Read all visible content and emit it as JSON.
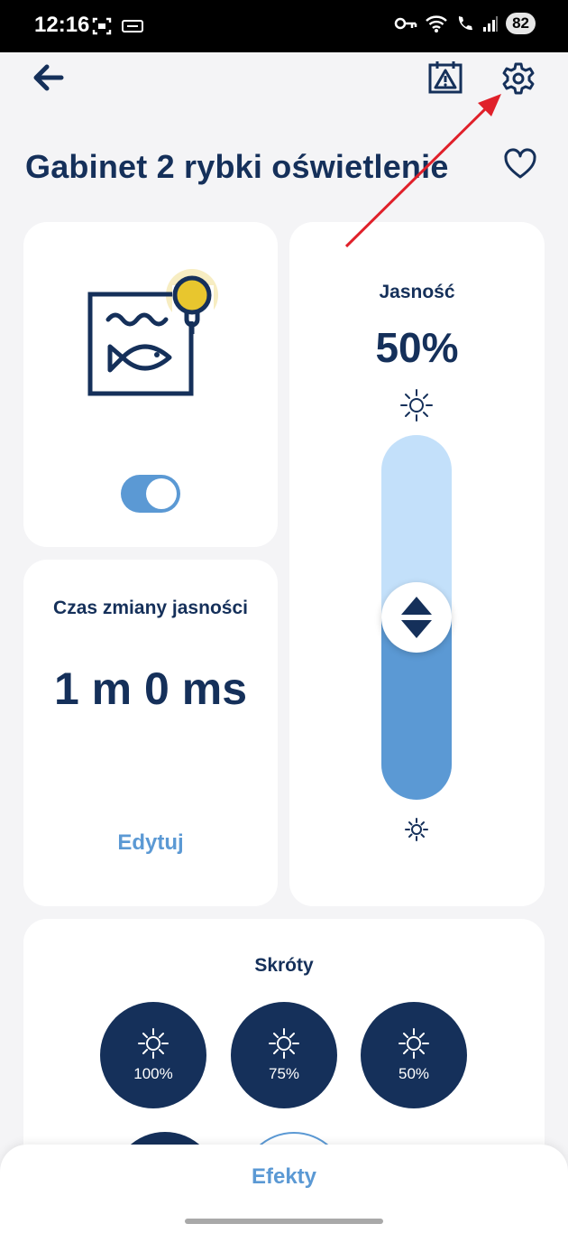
{
  "status_bar": {
    "time": "12:16",
    "battery": "82"
  },
  "device": {
    "name": "Gabinet 2 rybki oświetlenie",
    "power_on": true
  },
  "transition": {
    "label": "Czas zmiany jasności",
    "value": "1 m 0 ms",
    "edit_label": "Edytuj"
  },
  "brightness": {
    "label": "Jasność",
    "value_text": "50%",
    "level_percent": 50
  },
  "shortcuts": {
    "title": "Skróty",
    "items": [
      {
        "label": "100%"
      },
      {
        "label": "75%"
      },
      {
        "label": "50%"
      }
    ]
  },
  "bottom_sheet": {
    "effects_label": "Efekty"
  },
  "colors": {
    "navy": "#15305a",
    "accent": "#5b99d4",
    "slider_track": "#c3e0fa",
    "bulb": "#e8c62e",
    "annotation": "#e0202a"
  }
}
